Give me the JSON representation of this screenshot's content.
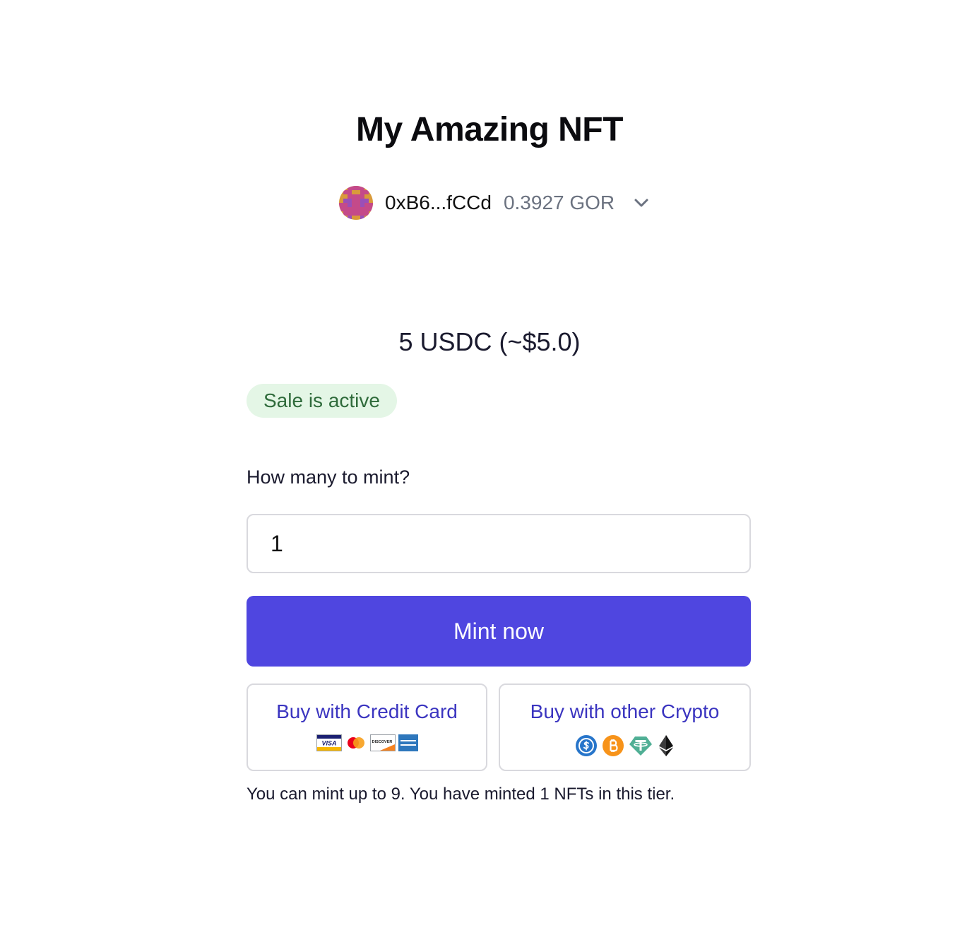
{
  "page": {
    "title": "My Amazing NFT"
  },
  "wallet": {
    "address": "0xB6...fCCd",
    "balance": "0.3927 GOR",
    "avatar_icon": "pixel-avatar-icon",
    "menu_icon": "chevron-down-icon"
  },
  "sale": {
    "price": "5 USDC (~$5.0)",
    "status": "Sale is active"
  },
  "mint": {
    "label": "How many to mint?",
    "quantity": "1",
    "button_label": "Mint now",
    "limit_note": "You can mint up to 9. You have minted 1 NFTs in this tier."
  },
  "buy_options": {
    "credit_card": {
      "label": "Buy with Credit Card",
      "icons": [
        "visa-icon",
        "mastercard-icon",
        "discover-icon",
        "american-express-icon"
      ],
      "visa_text": "VISA",
      "discover_text": "DISCOVER"
    },
    "crypto": {
      "label": "Buy with other Crypto",
      "icons": [
        "usdc-icon",
        "bitcoin-icon",
        "tether-icon",
        "ethereum-icon"
      ]
    }
  },
  "colors": {
    "accent": "#4f46e0",
    "accent_text": "#3b35c0",
    "badge_bg": "#e4f6e6",
    "badge_text": "#2f6b3b",
    "muted": "#6b7280",
    "border": "#d9d9de"
  }
}
